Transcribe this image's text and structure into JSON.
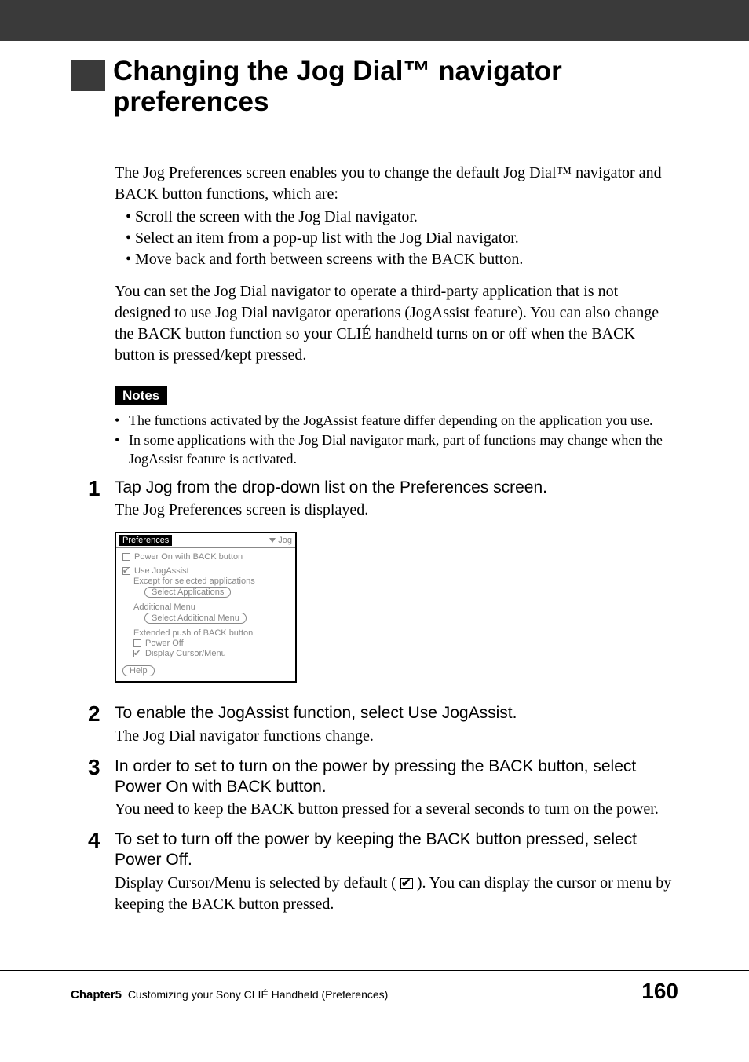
{
  "title": "Changing the Jog Dial™ navigator preferences",
  "intro_para": "The Jog Preferences screen enables you to change the default Jog Dial™ navigator and BACK button functions, which are:",
  "intro_bullets": [
    "Scroll the screen with the Jog Dial navigator.",
    "Select an item from a pop-up list with the Jog Dial navigator.",
    "Move back and forth between screens with the BACK button."
  ],
  "intro_para2": "You can set the Jog Dial navigator to operate a third-party application that is not designed to use Jog Dial navigator operations (JogAssist feature). You can also change the BACK button function so your CLIÉ handheld turns on or off when the BACK button is pressed/kept pressed.",
  "notes_label": "Notes",
  "notes": [
    "The functions activated by the JogAssist feature differ depending on the application you use.",
    "In some applications with the Jog Dial navigator mark, part of functions may change when the JogAssist feature is activated."
  ],
  "steps": [
    {
      "num": "1",
      "instr": "Tap Jog from the drop-down list on the Preferences screen.",
      "desc": "The Jog Preferences screen is displayed."
    },
    {
      "num": "2",
      "instr": "To enable the JogAssist function, select Use JogAssist.",
      "desc": "The Jog Dial navigator functions change."
    },
    {
      "num": "3",
      "instr": "In order to set to turn on the power by pressing the BACK button, select Power On with BACK button.",
      "desc": "You need to keep the BACK button pressed for a several seconds to turn on the power."
    },
    {
      "num": "4",
      "instr": "To set to turn off the power by keeping the BACK button pressed, select Power Off.",
      "desc_pre": "Display Cursor/Menu is selected by default ( ",
      "desc_post": " ).  You can display the cursor or menu by keeping the BACK button pressed."
    }
  ],
  "screenshot": {
    "header_title": "Preferences",
    "dropdown": "Jog",
    "power_on_label": "Power On with BACK button",
    "use_jogassist": "Use JogAssist",
    "except_line": "Except for selected applications",
    "select_apps_btn": "Select Applications",
    "additional_menu": "Additional Menu",
    "select_additional_btn": "Select Additional Menu",
    "extended_push": "Extended push of BACK button",
    "power_off_label": "Power Off",
    "display_cursor_label": "Display Cursor/Menu",
    "help_btn": "Help"
  },
  "footer": {
    "chapter": "Chapter5",
    "chapter_title": "Customizing your Sony CLIÉ Handheld (Preferences)",
    "page": "160"
  }
}
